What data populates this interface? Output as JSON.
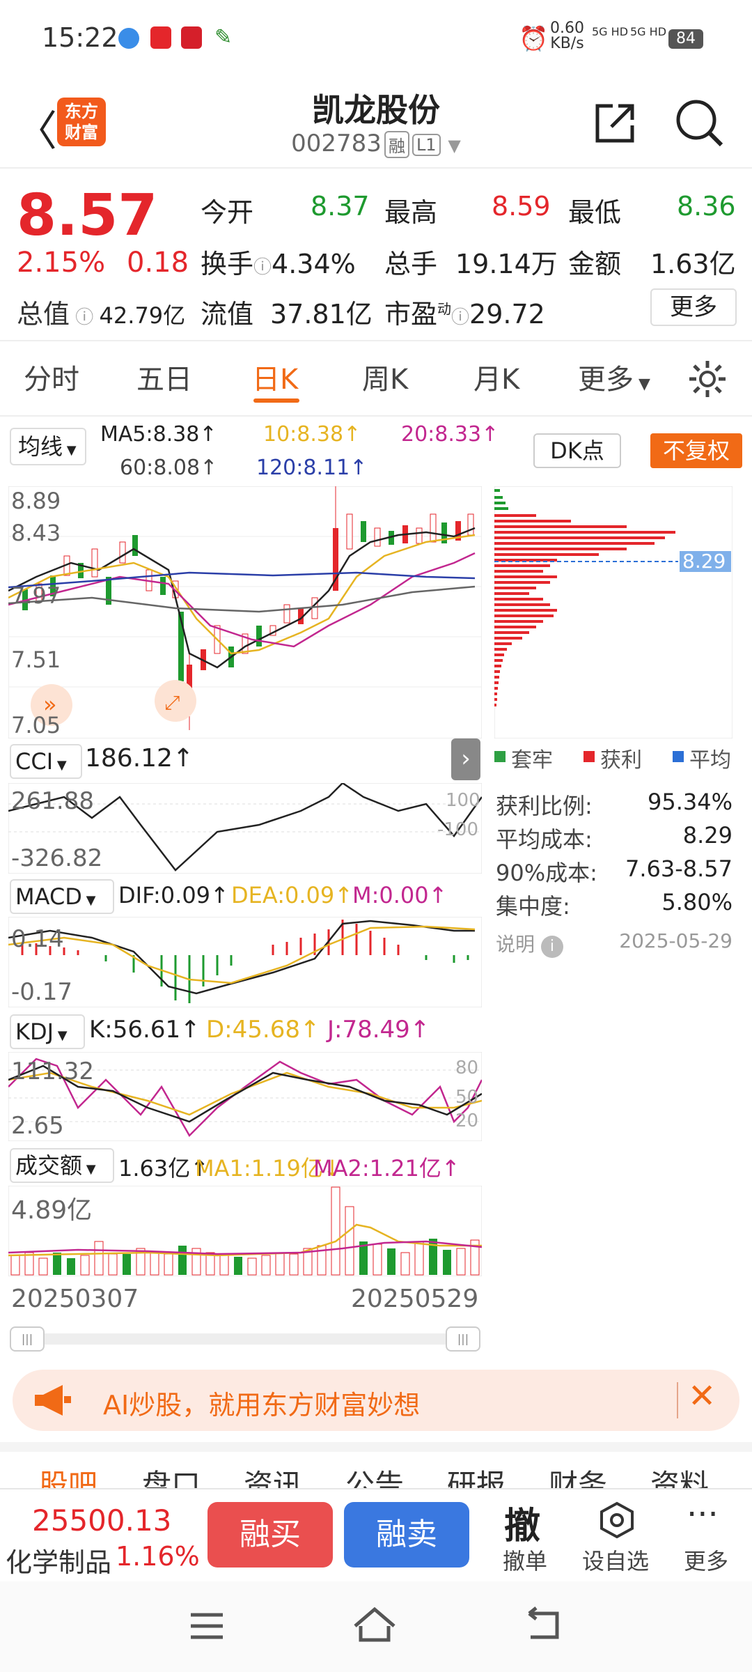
{
  "status": {
    "time": "15:22",
    "net_speed": "0.60",
    "net_unit": "KB/s",
    "sig1": "5G HD",
    "sig2": "5G HD",
    "battery": "84"
  },
  "header": {
    "logo_line1": "东方",
    "logo_line2": "财富",
    "title": "凯龙股份",
    "code": "002783",
    "tag1": "融",
    "tag2": "L1"
  },
  "quote": {
    "price": "8.57",
    "pct": "2.15%",
    "chg": "0.18",
    "open_lbl": "今开",
    "open": "8.37",
    "high_lbl": "最高",
    "high": "8.59",
    "low_lbl": "最低",
    "low": "8.36",
    "turn_lbl": "换手",
    "turn": "4.34%",
    "vol_lbl": "总手",
    "vol": "19.14万",
    "amt_lbl": "金额",
    "amt": "1.63亿",
    "cap_lbl": "总值",
    "cap": "42.79亿",
    "float_lbl": "流值",
    "float": "37.81亿",
    "pe_lbl": "市盈",
    "pe_sup": "动",
    "pe": "29.72",
    "more": "更多"
  },
  "tabs": [
    "分时",
    "五日",
    "日K",
    "周K",
    "月K",
    "更多"
  ],
  "ma": {
    "sel": "均线",
    "ma5": "MA5:8.38↑",
    "ma10": "10:8.38↑",
    "ma20": "20:8.33↑",
    "ma60": "60:8.08↑",
    "ma120": "120:8.11↑",
    "dk": "DK点",
    "fq": "不复权"
  },
  "price_axis": [
    "8.89",
    "8.43",
    "7.97",
    "7.51",
    "7.05"
  ],
  "chip": {
    "level": "8.29",
    "leg1": "套牢",
    "leg2": "获利",
    "leg3": "平均",
    "r1l": "获利比例:",
    "r1v": "95.34%",
    "r2l": "平均成本:",
    "r2v": "8.29",
    "r3l": "90%成本:",
    "r3v": "7.63-8.57",
    "r4l": "集中度:",
    "r4v": "5.80%",
    "note": "说明",
    "date": "2025-05-29"
  },
  "cci": {
    "sel": "CCI",
    "val": "186.12↑",
    "top": "261.88",
    "bot": "-326.82",
    "r100": "100",
    "rm100": "-100"
  },
  "macd": {
    "sel": "MACD",
    "dif": "DIF:0.09↑",
    "dea": "DEA:0.09↑",
    "m": "M:0.00↑",
    "top": "0.14",
    "bot": "-0.17"
  },
  "kdj": {
    "sel": "KDJ",
    "k": "K:56.61↑",
    "d": "D:45.68↑",
    "j": "J:78.49↑",
    "top": "111.32",
    "bot": "2.65",
    "r80": "80",
    "r50": "50",
    "r20": "20"
  },
  "volume": {
    "sel": "成交额",
    "val": "1.63亿↑",
    "ma1": "MA1:1.19亿↓",
    "ma2": "MA2:1.21亿↑",
    "top": "4.89亿"
  },
  "dates": {
    "start": "20250307",
    "end": "20250529"
  },
  "banner": {
    "text": "AI炒股，就用东方财富妙想"
  },
  "subtabs": [
    "股吧",
    "盘口",
    "资讯",
    "公告",
    "研报",
    "财务",
    "资料"
  ],
  "bottom": {
    "index": "25500.13",
    "sector": "化学制品",
    "sector_pct": "1.16%",
    "buy": "融买",
    "sell": "融卖",
    "cancel_icon": "撤",
    "cancel": "撤单",
    "watch": "设自选",
    "more": "更多"
  },
  "colors": {
    "up": "#e4262b",
    "down": "#1e9a2f",
    "accent": "#f16a16",
    "ma5": "#222222",
    "ma10": "#e6b422",
    "ma20": "#c2278f",
    "ma60": "#666666",
    "ma120": "#2b3fa8"
  }
}
